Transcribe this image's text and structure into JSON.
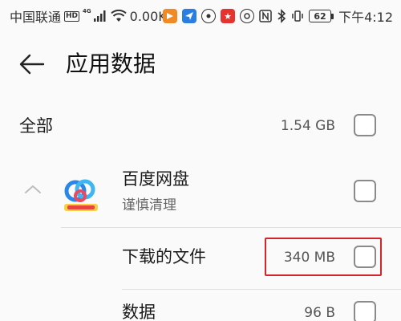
{
  "status_bar": {
    "carrier": "中国联通",
    "hd_badge": "HD",
    "network_type": "4G",
    "speed": "0.00K/s",
    "battery": "62",
    "time": "下午4:12"
  },
  "header": {
    "title": "应用数据"
  },
  "all_row": {
    "label": "全部",
    "size": "1.54 GB"
  },
  "app": {
    "name": "百度网盘",
    "subtitle": "谨慎清理"
  },
  "items": [
    {
      "label": "下载的文件",
      "size": "340 MB"
    },
    {
      "label": "数据",
      "size": "96 B"
    }
  ],
  "colors": {
    "highlight": "#d4252b",
    "background": "#fafafa"
  }
}
